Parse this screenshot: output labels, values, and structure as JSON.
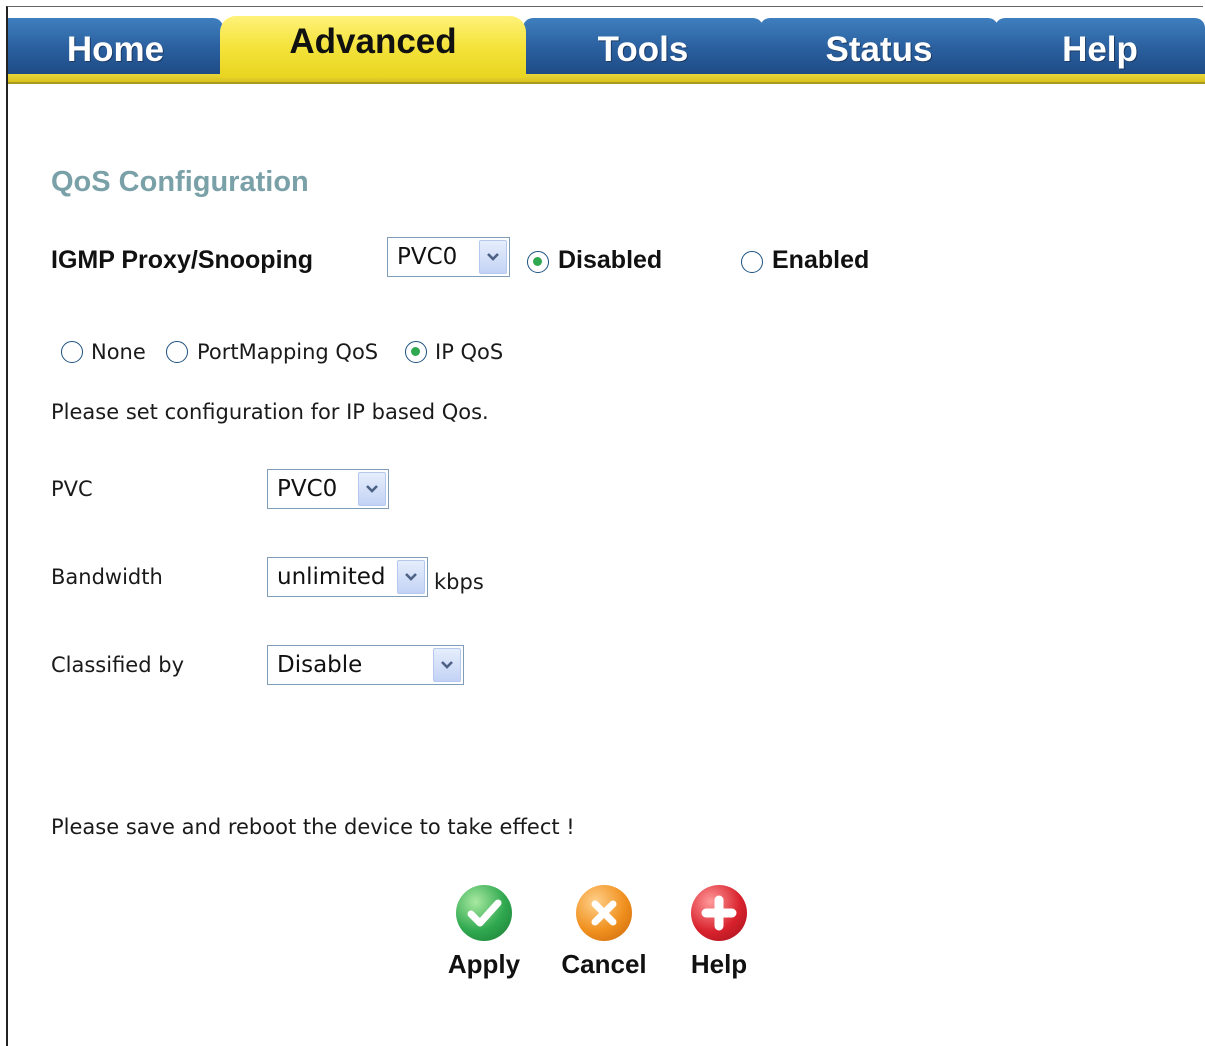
{
  "tabs": [
    {
      "label": "Home"
    },
    {
      "label": "Advanced"
    },
    {
      "label": "Tools"
    },
    {
      "label": "Status"
    },
    {
      "label": "Help"
    }
  ],
  "active_tab": "Advanced",
  "page": {
    "title": "QoS Configuration",
    "igmp": {
      "label": "IGMP Proxy/Snooping",
      "pvc_value": "PVC0",
      "options": [
        {
          "label": "Disabled",
          "checked": true
        },
        {
          "label": "Enabled",
          "checked": false
        }
      ]
    },
    "qos_mode": {
      "options": [
        {
          "label": "None",
          "checked": false
        },
        {
          "label": "PortMapping QoS",
          "checked": false
        },
        {
          "label": "IP QoS",
          "checked": true
        }
      ]
    },
    "instruction": "Please set configuration for IP based Qos.",
    "fields": {
      "pvc": {
        "label": "PVC",
        "value": "PVC0"
      },
      "bandwidth": {
        "label": "Bandwidth",
        "value": "unlimited",
        "unit": "kbps"
      },
      "classified_by": {
        "label": "Classified by",
        "value": "Disable"
      }
    },
    "notice": "Please save and reboot the device to take effect !",
    "buttons": {
      "apply": "Apply",
      "cancel": "Cancel",
      "help": "Help"
    }
  },
  "colors": {
    "tab_blue": "#2a5f9e",
    "tab_active_yellow": "#f4e33a",
    "title_teal": "#7aa0a8",
    "apply_green": "#2fa84f",
    "cancel_orange": "#f0901e",
    "help_red": "#d9232e"
  },
  "icons": {
    "apply": "check-icon",
    "cancel": "x-icon",
    "help": "plus-icon",
    "dropdown": "chevron-down-icon"
  }
}
